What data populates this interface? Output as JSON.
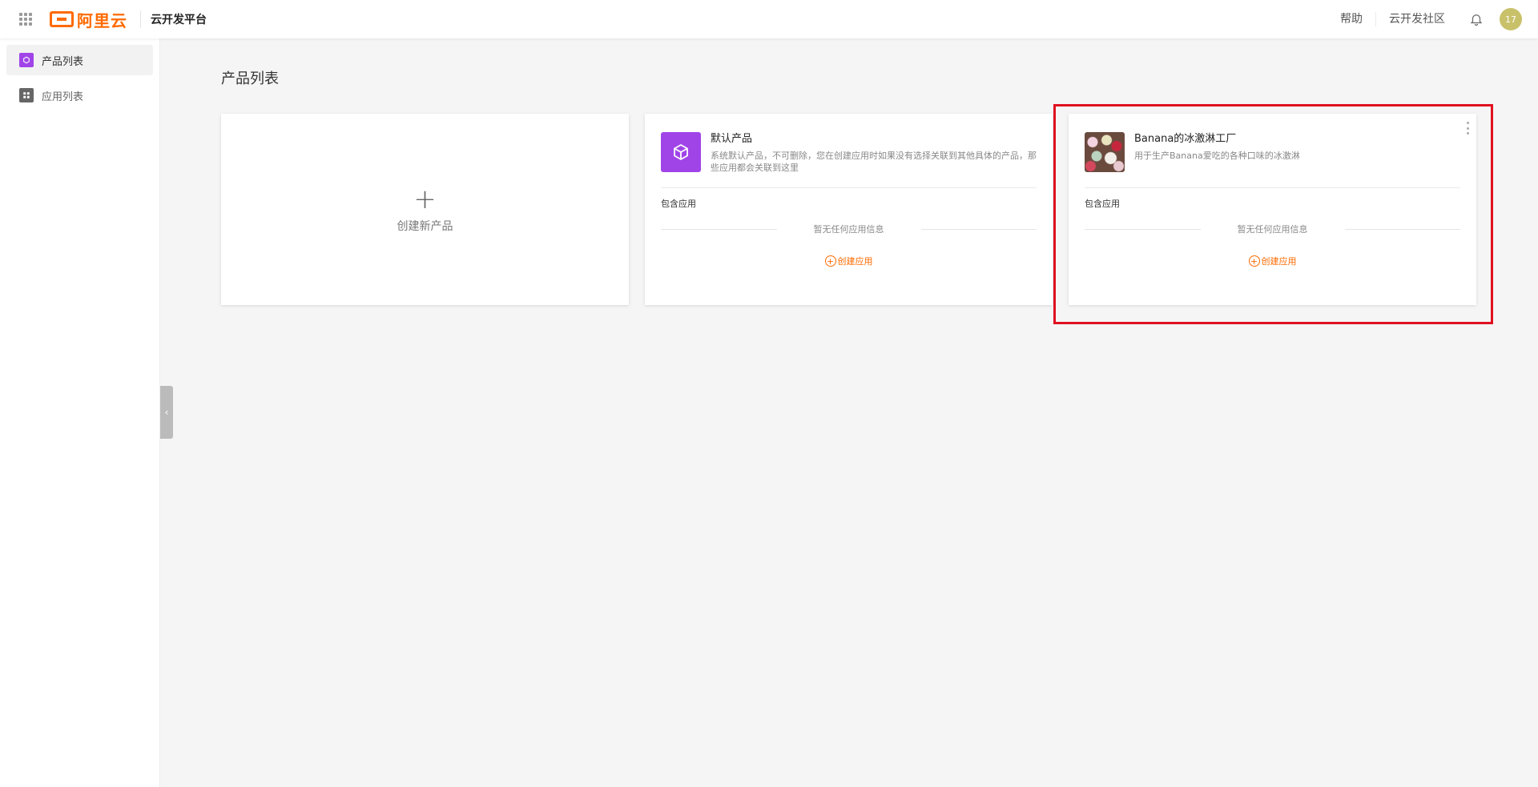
{
  "header": {
    "brand": "阿里云",
    "platform": "云开发平台",
    "help": "帮助",
    "community": "云开发社区",
    "avatar_text": "17",
    "brand_color": "#ff6a00"
  },
  "sidebar": {
    "items": [
      {
        "label": "产品列表",
        "icon": "cube-icon",
        "active": true
      },
      {
        "label": "应用列表",
        "icon": "apps-icon",
        "active": false
      }
    ]
  },
  "main": {
    "title": "产品列表",
    "new_product_label": "创建新产品",
    "products": [
      {
        "name": "默认产品",
        "description": "系统默认产品，不可删除，您在创建应用时如果没有选择关联到其他具体的产品，那些应用都会关联到这里",
        "section_label": "包含应用",
        "empty_text": "暂无任何应用信息",
        "create_app": "创建应用",
        "icon": "cube-icon"
      },
      {
        "name": "Banana的冰激淋工厂",
        "description": "用于生产Banana爱吃的各种口味的冰激淋",
        "section_label": "包含应用",
        "empty_text": "暂无任何应用信息",
        "create_app": "创建应用",
        "icon": "ice-cream-image"
      }
    ]
  }
}
